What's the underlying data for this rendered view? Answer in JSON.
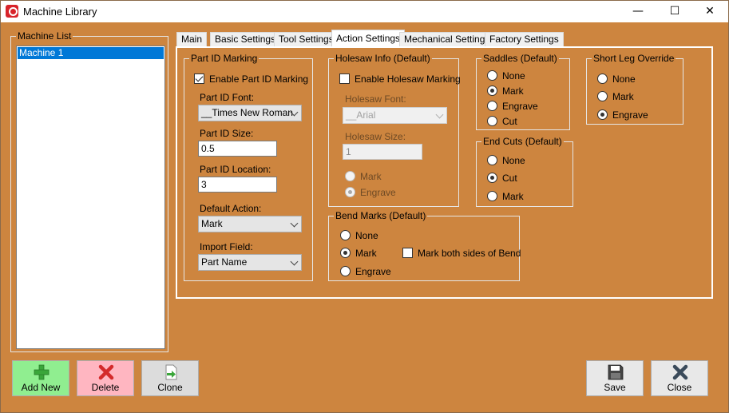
{
  "window": {
    "title": "Machine Library",
    "min_glyph": "—",
    "max_glyph": "☐",
    "close_glyph": "✕"
  },
  "machine_list": {
    "label": "Machine List",
    "items": [
      "Machine 1"
    ]
  },
  "tabs": [
    "Main",
    "Basic Settings",
    "Tool Settings",
    "Action Settings",
    "Mechanical Settings",
    "Factory Settings"
  ],
  "active_tab": "Action Settings",
  "part_id": {
    "title": "Part ID Marking",
    "enable_label": "Enable Part ID Marking",
    "enable_checked": true,
    "font_label": "Part ID Font:",
    "font_value": "__Times New Roman",
    "size_label": "Part ID Size:",
    "size_value": "0.5",
    "location_label": "Part ID Location:",
    "location_value": "3",
    "default_action_label": "Default Action:",
    "default_action_value": "Mark",
    "import_field_label": "Import Field:",
    "import_field_value": "Part Name"
  },
  "holesaw": {
    "title": "Holesaw Info (Default)",
    "enable_label": "Enable Holesaw Marking",
    "enable_checked": false,
    "font_label": "Holesaw Font:",
    "font_value": "__Arial",
    "size_label": "Holesaw Size:",
    "size_value": "1",
    "options": [
      "Mark",
      "Engrave"
    ],
    "selected": "Engrave"
  },
  "saddles": {
    "title": "Saddles (Default)",
    "options": [
      "None",
      "Mark",
      "Engrave",
      "Cut"
    ],
    "selected": "Mark"
  },
  "short_leg": {
    "title": "Short Leg Override",
    "options": [
      "None",
      "Mark",
      "Engrave"
    ],
    "selected": "Engrave"
  },
  "end_cuts": {
    "title": "End Cuts (Default)",
    "options": [
      "None",
      "Cut",
      "Mark"
    ],
    "selected": "Cut"
  },
  "bend_marks": {
    "title": "Bend Marks (Default)",
    "options": [
      "None",
      "Mark",
      "Engrave"
    ],
    "selected": "Mark",
    "both_sides_label": "Mark both sides of Bend",
    "both_sides_checked": false
  },
  "buttons": {
    "add_new": "Add New",
    "delete": "Delete",
    "clone": "Clone",
    "save": "Save",
    "close": "Close"
  },
  "colors": {
    "background": "#cd853f",
    "selection": "#0078d7",
    "add_new_bg": "#90ee90",
    "delete_bg": "#ffb6c1"
  }
}
